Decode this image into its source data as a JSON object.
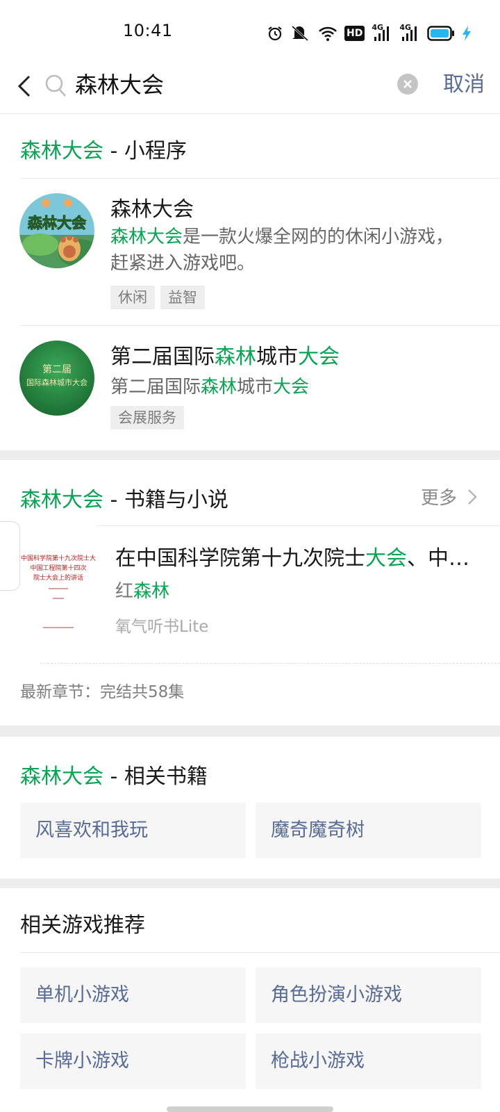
{
  "status_bar": {
    "time": "10:41",
    "icons": [
      "alarm-icon",
      "mute-icon",
      "wifi-icon",
      "hd-icon",
      "signal-4g-icon",
      "signal-4g-icon",
      "battery-icon",
      "charging-icon"
    ],
    "hd_label": "HD",
    "network_label": "4G"
  },
  "search": {
    "query": "森林大会",
    "cancel_label": "取消"
  },
  "colors": {
    "highlight": "#07a553",
    "link": "#576b95",
    "divider": "#ededed"
  },
  "mini_program_section": {
    "title_keyword": "森林大会",
    "title_rest": " - 小程序",
    "items": [
      {
        "name": "森林大会",
        "desc_keyword": "森林大会",
        "desc_rest": "是一款火爆全网的的休闲小游戏，赶紧进入游戏吧。",
        "icon_text": "森林大会",
        "tags": [
          "休闲",
          "益智"
        ]
      },
      {
        "name_parts": [
          "第二届国际",
          "森林",
          "城市",
          "大会"
        ],
        "desc_parts": [
          "第二届国际",
          "森林",
          "城市",
          "大会"
        ],
        "icon_lines": [
          "第二届",
          "国际森林城市大会"
        ],
        "tags": [
          "会展服务"
        ]
      }
    ]
  },
  "books_section": {
    "title_keyword": "森林大会",
    "title_rest": " - 书籍与小说",
    "more_label": "更多",
    "book": {
      "title_parts": [
        "在中国科学院第十九次院士",
        "大会",
        "、中国工程院第十四次院士大会上的讲话"
      ],
      "author_parts": [
        "红",
        "森林"
      ],
      "source": "氧气听书Lite",
      "chapter": "最新章节：完结共58集",
      "cover_lines": [
        "在中国科学院第十九次院士大会",
        "中国工程院第十四次",
        "院士大会上的讲话"
      ]
    }
  },
  "related_books_section": {
    "title_keyword": "森林大会",
    "title_rest": " - 相关书籍",
    "items": [
      "风喜欢和我玩",
      "魔奇魔奇树"
    ]
  },
  "related_games_section": {
    "title": "相关游戏推荐",
    "items": [
      "单机小游戏",
      "角色扮演小游戏",
      "卡牌小游戏",
      "枪战小游戏"
    ]
  }
}
